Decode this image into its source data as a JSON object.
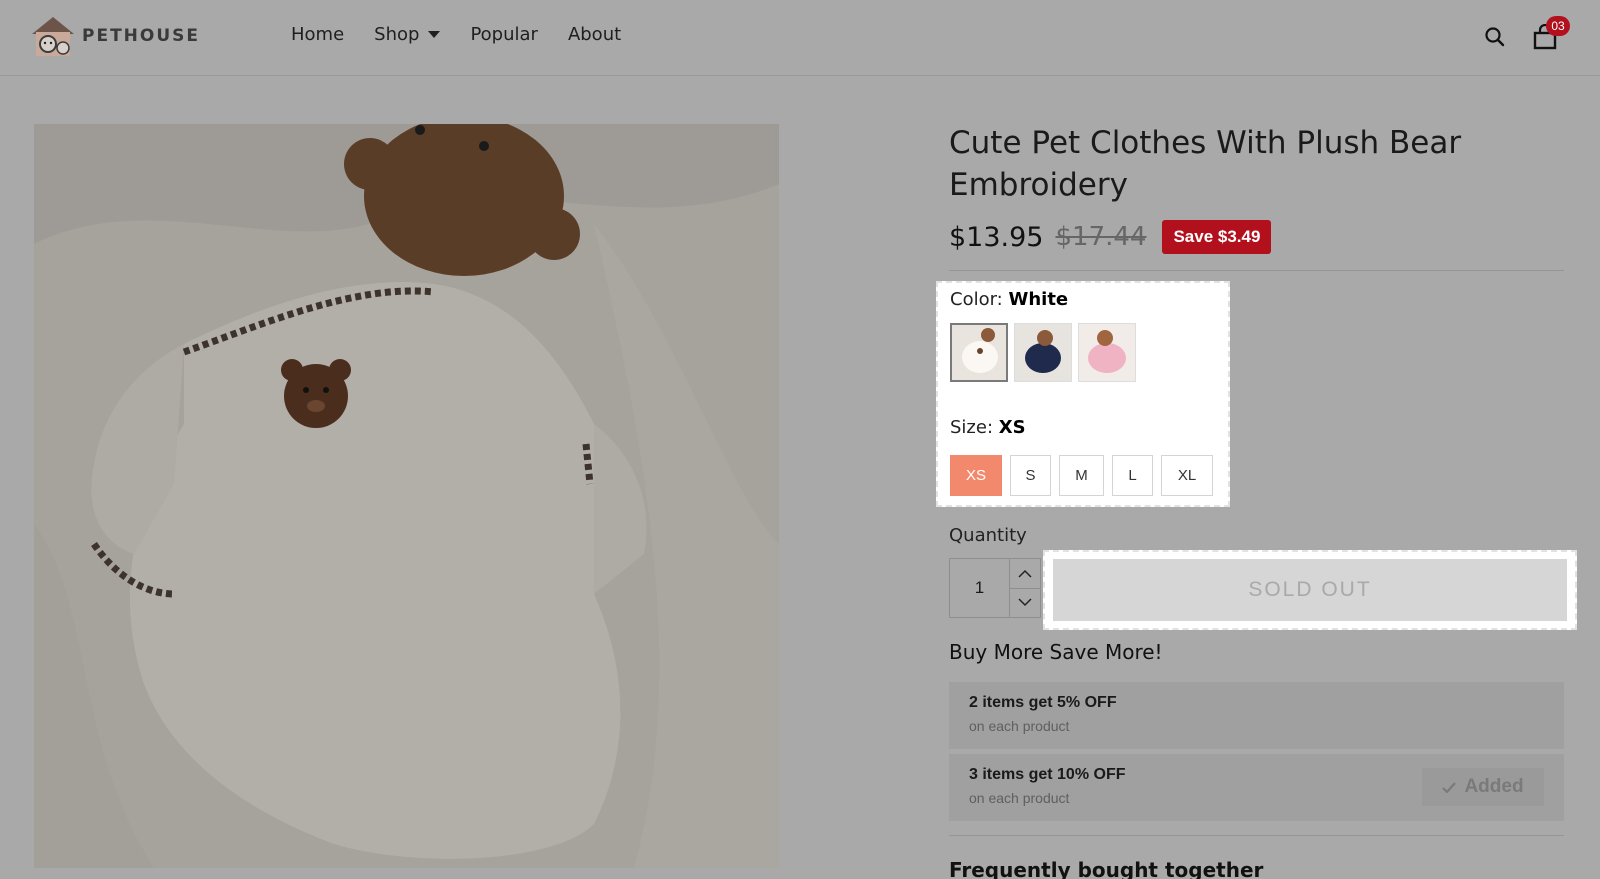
{
  "brand": {
    "name": "PETHOUSE",
    "logo_icon": "dog-house-logo-icon"
  },
  "nav": {
    "items": [
      {
        "label": "Home"
      },
      {
        "label": "Shop",
        "has_dropdown": true
      },
      {
        "label": "Popular"
      },
      {
        "label": "About"
      }
    ]
  },
  "header_icons": {
    "search": "search-icon",
    "cart": "cart-icon",
    "cart_count": "03"
  },
  "colors": {
    "sale_red": "#b3101e",
    "size_active": "#f3896c"
  },
  "product": {
    "title": "Cute Pet Clothes With Plush Bear Embroidery",
    "price": "$13.95",
    "compare_price": "$17.44",
    "save_label": "Save $3.49",
    "color_label": "Color:",
    "color_value": "White",
    "swatches": [
      {
        "name": "White",
        "selected": true
      },
      {
        "name": "Navy",
        "selected": false
      },
      {
        "name": "Pink",
        "selected": false
      }
    ],
    "size_label": "Size:",
    "size_value": "XS",
    "sizes": [
      "XS",
      "S",
      "M",
      "L",
      "XL"
    ],
    "quantity_label": "Quantity",
    "quantity": "1",
    "sold_out_label": "SOLD OUT"
  },
  "bundle": {
    "title": "Buy More Save More!",
    "offers": [
      {
        "main": "2 items get 5% OFF",
        "sub": "on each product"
      },
      {
        "main": "3 items get 10% OFF",
        "sub": "on each product",
        "action": "Added"
      }
    ]
  },
  "frequently_bought": {
    "title": "Frequently bought together"
  }
}
